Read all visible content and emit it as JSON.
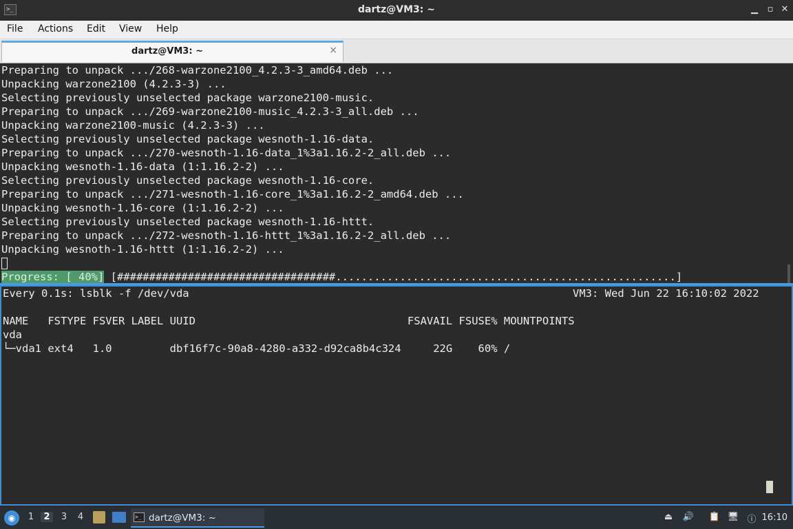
{
  "window": {
    "title": "dartz@VM3: ~",
    "minimize_icon": "minimize-icon",
    "maximize_icon": "maximize-icon",
    "close_icon": "close-icon"
  },
  "menu": {
    "file": "File",
    "actions": "Actions",
    "edit": "Edit",
    "view": "View",
    "help": "Help"
  },
  "tab": {
    "title": "dartz@VM3: ~",
    "close": "×"
  },
  "pane_top": {
    "lines": [
      "Preparing to unpack .../268-warzone2100_4.2.3-3_amd64.deb ...",
      "Unpacking warzone2100 (4.2.3-3) ...",
      "Selecting previously unselected package warzone2100-music.",
      "Preparing to unpack .../269-warzone2100-music_4.2.3-3_all.deb ...",
      "Unpacking warzone2100-music (4.2.3-3) ...",
      "Selecting previously unselected package wesnoth-1.16-data.",
      "Preparing to unpack .../270-wesnoth-1.16-data_1%3a1.16.2-2_all.deb ...",
      "Unpacking wesnoth-1.16-data (1:1.16.2-2) ...",
      "Selecting previously unselected package wesnoth-1.16-core.",
      "Preparing to unpack .../271-wesnoth-1.16-core_1%3a1.16.2-2_amd64.deb ...",
      "Unpacking wesnoth-1.16-core (1:1.16.2-2) ...",
      "Selecting previously unselected package wesnoth-1.16-httt.",
      "Preparing to unpack .../272-wesnoth-1.16-httt_1%3a1.16.2-2_all.deb ...",
      "Unpacking wesnoth-1.16-httt (1:1.16.2-2) ..."
    ],
    "progress_label": "Progress: [ 40%]",
    "progress_bar": " [##################################.....................................................]",
    "progress_percent": 40
  },
  "pane_bottom": {
    "header_left": "Every 0.1s: lsblk -f /dev/vda",
    "header_right": "VM3: Wed Jun 22 16:10:02 2022",
    "columns_line": "NAME   FSTYPE FSVER LABEL UUID                                 FSAVAIL FSUSE% MOUNTPOINTS",
    "row1": "vda",
    "row2": "└─vda1 ext4   1.0         dbf16f7c-90a8-4280-a332-d92ca8b4c324     22G    60% /"
  },
  "taskbar": {
    "workspaces": [
      "1",
      "2",
      "3",
      "4"
    ],
    "active_workspace": "2",
    "task_label": "dartz@VM3: ~",
    "clock": "16:10"
  }
}
